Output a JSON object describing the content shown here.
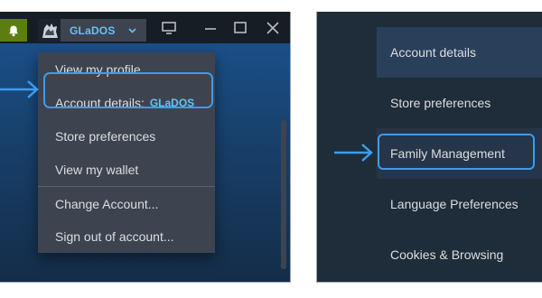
{
  "titlebar": {
    "account_name": "GLaDOS",
    "icons": [
      "bell-icon",
      "avatar",
      "chevron-down-icon",
      "monitor-icon",
      "minimize-icon",
      "maximize-icon",
      "close-icon"
    ]
  },
  "account_menu": {
    "items": [
      {
        "label": "View my profile"
      },
      {
        "label": "Account details:",
        "suffix": "GLaDOS"
      },
      {
        "label": "Store preferences"
      },
      {
        "label": "View my wallet"
      },
      {
        "label": "Change Account..."
      },
      {
        "label": "Sign out of account..."
      }
    ]
  },
  "settings_nav": {
    "items": [
      {
        "label": "Account details"
      },
      {
        "label": "Store preferences"
      },
      {
        "label": "Family Management"
      },
      {
        "label": "Language Preferences"
      },
      {
        "label": "Cookies & Browsing"
      }
    ]
  },
  "colors": {
    "accent": "#3b9cf0",
    "username": "#67c1f5",
    "notification_green": "#5c7e10",
    "menu_bg": "#3d4450",
    "nav_bg": "#1f2c3a"
  }
}
